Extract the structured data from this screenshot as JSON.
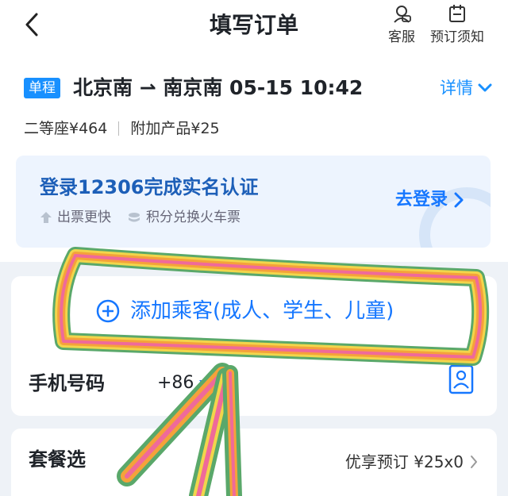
{
  "header": {
    "title": "填写订单",
    "actions": [
      {
        "label": "客服",
        "icon": "customer-service-icon"
      },
      {
        "label": "预订须知",
        "icon": "calendar-notice-icon"
      }
    ]
  },
  "trip": {
    "tag": "单程",
    "route": "北京南 ⇀ 南京南   05-15  10:42",
    "detail_label": "详情"
  },
  "prices": {
    "seat": "二等座¥464",
    "addon": "附加产品¥25"
  },
  "login_banner": {
    "title": "登录12306完成实名认证",
    "tips": [
      "出票更快",
      "积分兑换火车票"
    ],
    "button_label": "去登录"
  },
  "passenger": {
    "add_label": "添加乘客(成人、学生、儿童)",
    "phone_label": "手机号码",
    "country_code": "+86"
  },
  "package": {
    "label": "套餐选",
    "value": "优享预订 ¥25x0"
  },
  "colors": {
    "accent": "#1677ff",
    "tag_bg": "#1890ff",
    "banner_bg": "#edf4fe",
    "annotation": [
      "#ef6a9a",
      "#f5a23a",
      "#f2d54b",
      "#5aa86a"
    ]
  }
}
